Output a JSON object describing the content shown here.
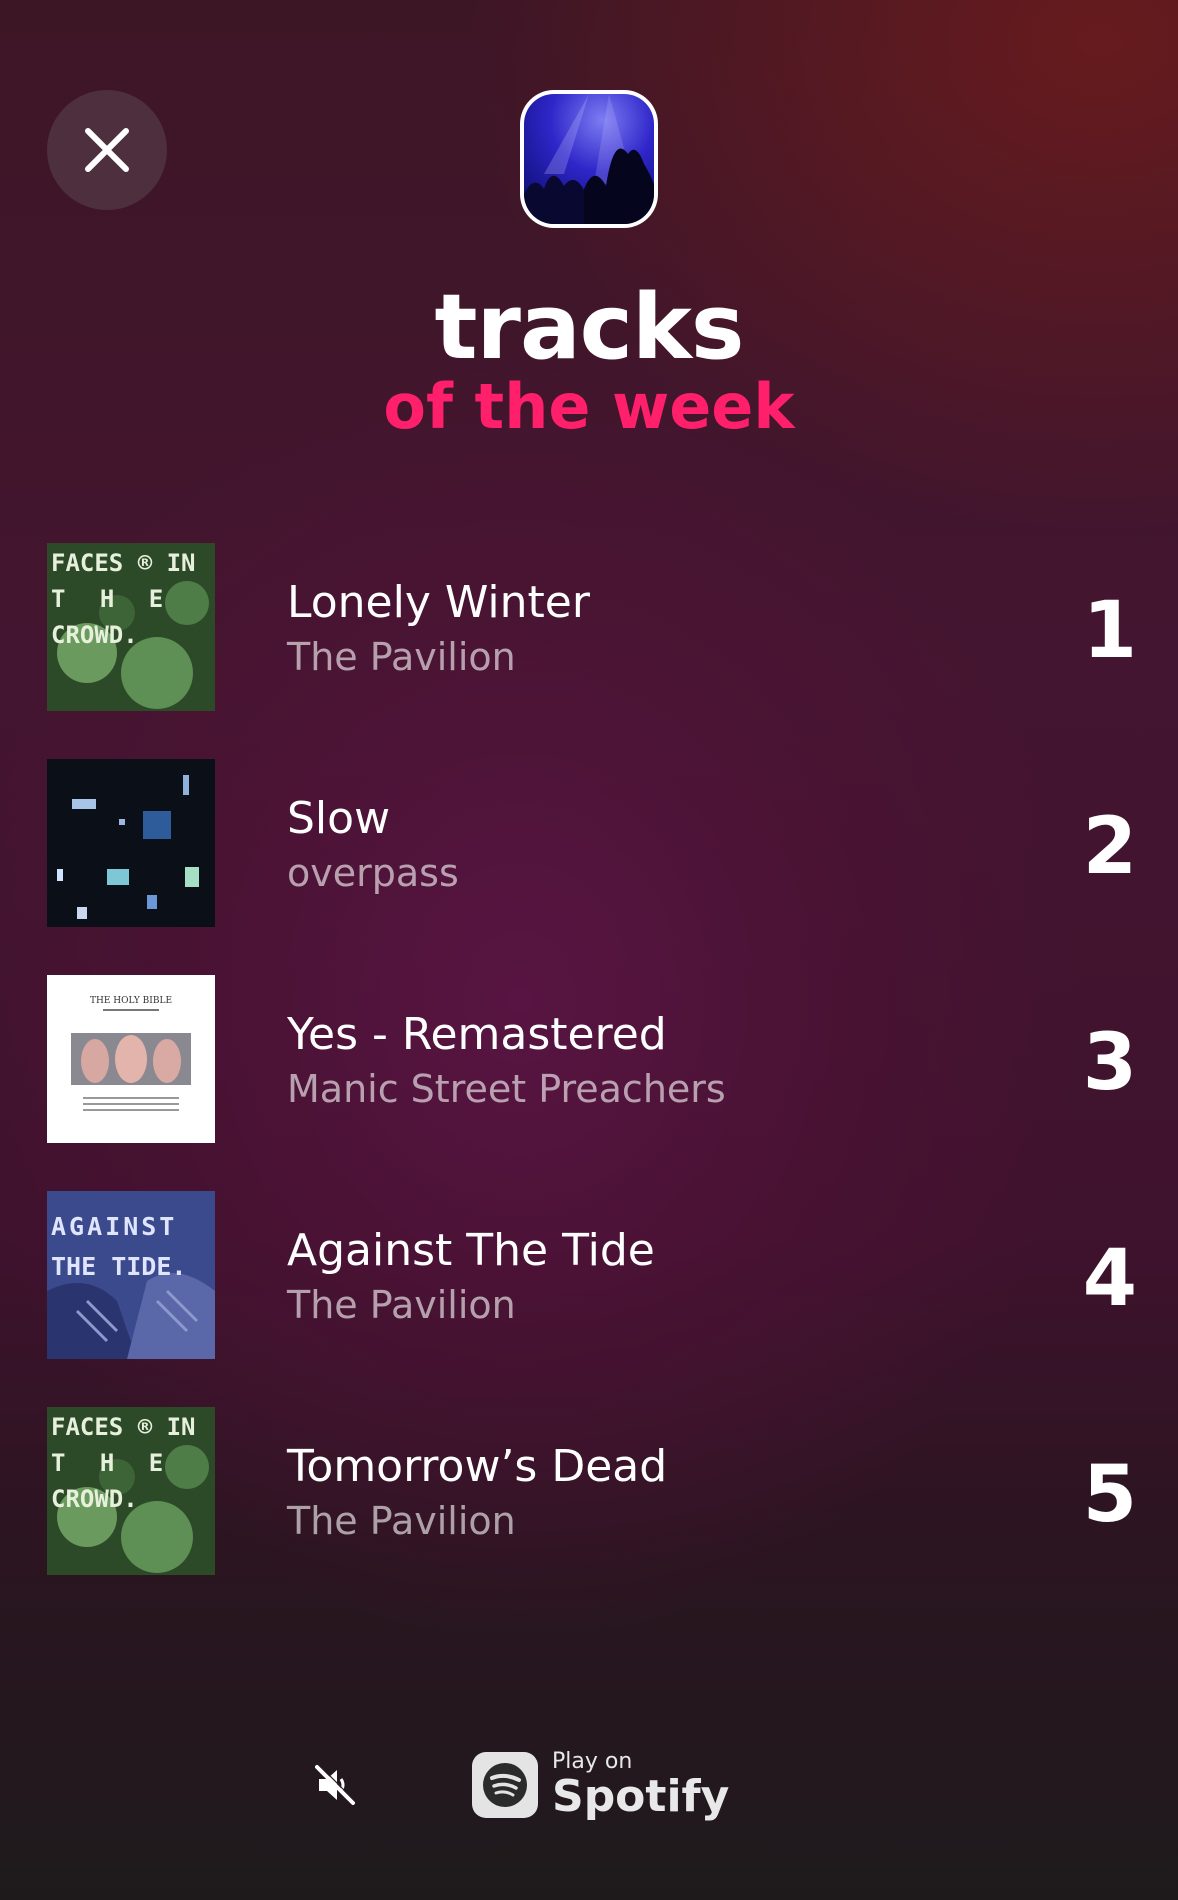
{
  "header": {
    "title_line_1": "tracks",
    "title_line_2": "of the week",
    "accent_color": "#ff1f6b"
  },
  "icons": {
    "close": "close-icon",
    "mute": "volume-muted-icon",
    "spotify": "spotify-logo-icon"
  },
  "tracks": [
    {
      "rank": "1",
      "title": "Lonely Winter",
      "artist": "The Pavilion",
      "art_text": [
        "FACES ® IN",
        "T H E",
        "CROWD."
      ]
    },
    {
      "rank": "2",
      "title": "Slow",
      "artist": "overpass"
    },
    {
      "rank": "3",
      "title": "Yes - Remastered",
      "artist": "Manic Street Preachers",
      "art_text": [
        "THE HOLY BIBLE"
      ]
    },
    {
      "rank": "4",
      "title": "Against The Tide",
      "artist": "The Pavilion",
      "art_text": [
        "AGAINST",
        "THE TIDE."
      ]
    },
    {
      "rank": "5",
      "title": "Tomorrow’s Dead",
      "artist": "The Pavilion",
      "art_text": [
        "FACES ® IN",
        "T H E",
        "CROWD."
      ]
    }
  ],
  "footer": {
    "play_on": "Play on",
    "spotify": "Spotify"
  }
}
